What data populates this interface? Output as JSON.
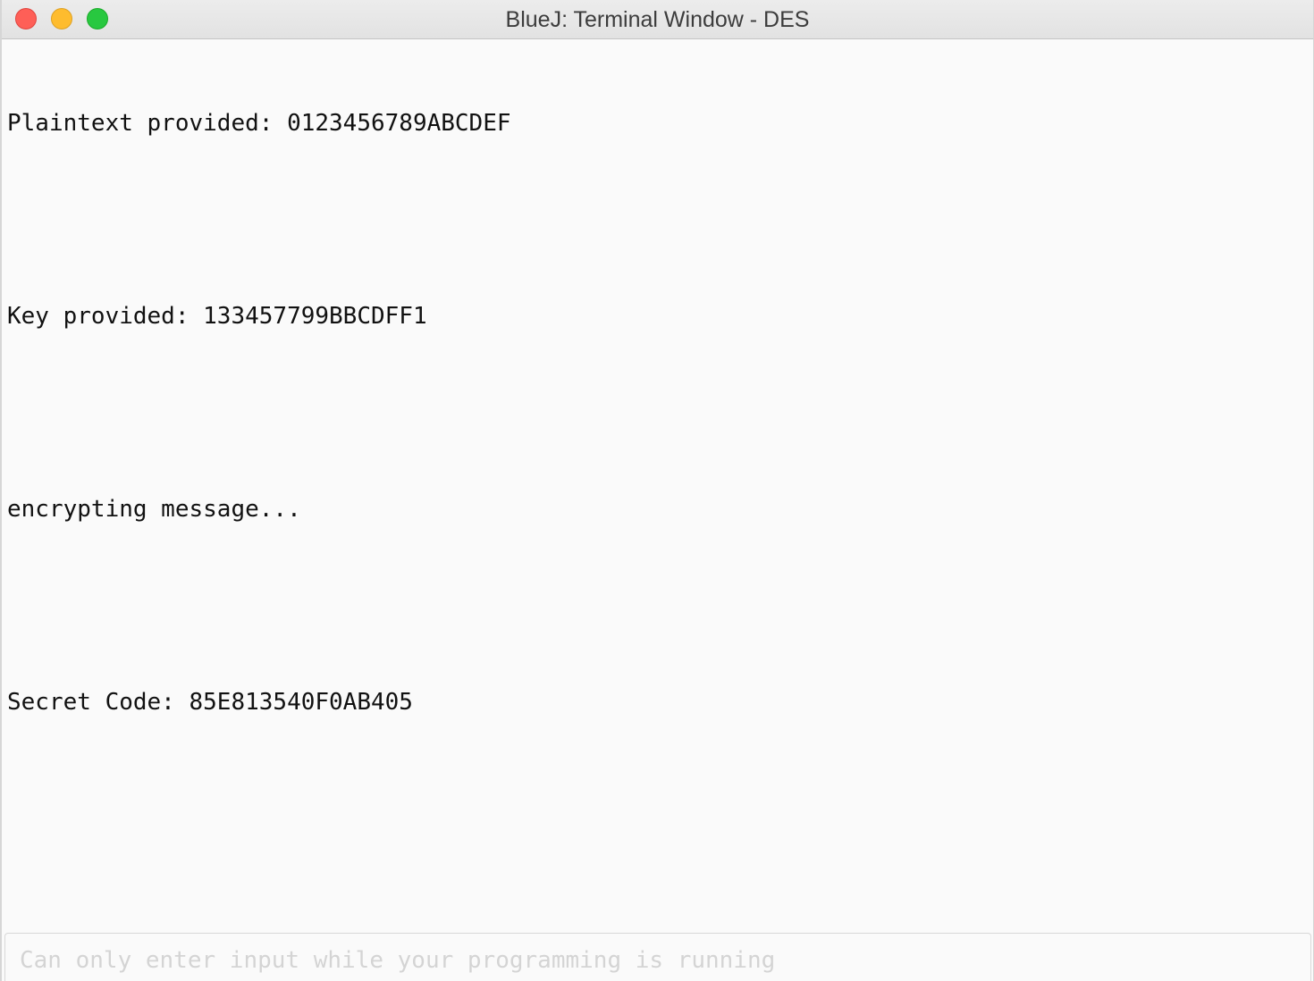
{
  "window": {
    "title": "BlueJ: Terminal Window - DES"
  },
  "terminal": {
    "lines": [
      "Plaintext provided: 0123456789ABCDEF",
      "",
      "Key provided: 133457799BBCDFF1",
      "",
      "encrypting message...",
      "",
      "Secret Code: 85E813540F0AB405"
    ]
  },
  "input": {
    "placeholder": "Can only enter input while your programming is running",
    "value": ""
  }
}
